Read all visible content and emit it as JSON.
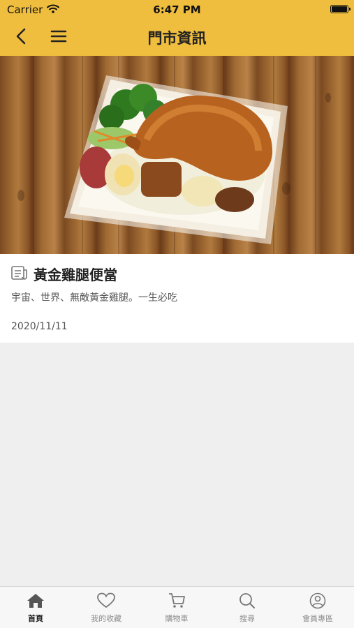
{
  "status_bar": {
    "carrier": "Carrier",
    "time": "6:47 PM"
  },
  "nav": {
    "title": "門市資訊",
    "back_icon": "chevron-left-icon",
    "menu_icon": "hamburger-menu-icon"
  },
  "item": {
    "title": "黃金雞腿便當",
    "description": "宇宙、世界、無敵黃金雞腿。一生必吃",
    "date": "2020/11/11",
    "icon": "news-icon",
    "image": "chicken-leg-bento-photo"
  },
  "tabs": [
    {
      "label": "首頁",
      "icon": "home-icon",
      "active": true
    },
    {
      "label": "我的收藏",
      "icon": "heart-icon",
      "active": false
    },
    {
      "label": "購物車",
      "icon": "cart-icon",
      "active": false
    },
    {
      "label": "搜尋",
      "icon": "search-icon",
      "active": false
    },
    {
      "label": "會員專區",
      "icon": "user-icon",
      "active": false
    }
  ],
  "colors": {
    "header": "#f0be3e",
    "background": "#efefef",
    "tab_active": "#222222",
    "tab_inactive": "#8e8e8e"
  }
}
